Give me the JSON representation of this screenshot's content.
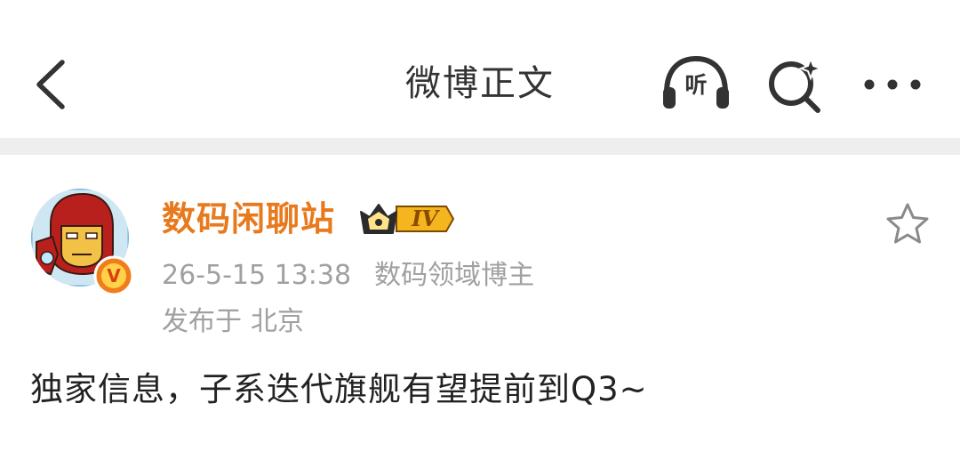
{
  "header": {
    "title": "微博正文",
    "listen_label": "听"
  },
  "post": {
    "author": {
      "name": "数码闲聊站",
      "rank": "IV",
      "verified_mark": "V"
    },
    "time": "26-5-15 13:38",
    "author_tag": "数码领域博主",
    "location_prefix": "发布于",
    "location": "北京",
    "text": "独家信息，子系迭代旗舰有望提前到Q3~"
  },
  "icons": {
    "back": "chevron-left-icon",
    "listen": "headphones-icon",
    "search": "search-sparkle-icon",
    "more": "ellipsis-icon",
    "favorite": "star-outline-icon"
  },
  "colors": {
    "username": "#e8791c",
    "meta": "#a0a0a0",
    "badge_gold": "#f5b51f",
    "verified_orange": "#f07d1a",
    "band": "#eeeeee"
  }
}
